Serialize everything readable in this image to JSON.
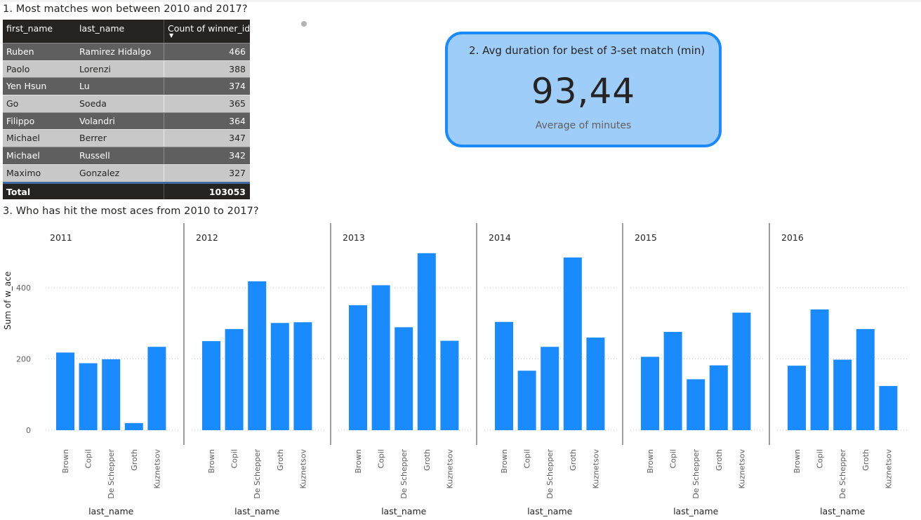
{
  "matches_table": {
    "heading": "1. Most matches won between 2010 and 2017?",
    "columns": [
      "first_name",
      "last_name",
      "Count of winner_id"
    ],
    "sort_indicator": "▼",
    "rows": [
      [
        "Ruben",
        "Ramirez Hidalgo",
        "466"
      ],
      [
        "Paolo",
        "Lorenzi",
        "388"
      ],
      [
        "Yen Hsun",
        "Lu",
        "374"
      ],
      [
        "Go",
        "Soeda",
        "365"
      ],
      [
        "Filippo",
        "Volandri",
        "364"
      ],
      [
        "Michael",
        "Berrer",
        "347"
      ],
      [
        "Michael",
        "Russell",
        "342"
      ],
      [
        "Maximo",
        "Gonzalez",
        "327"
      ]
    ],
    "total_label": "Total",
    "total_value": "103053"
  },
  "duration_card": {
    "title": "2. Avg duration for best of 3-set match (min)",
    "value": "93,44",
    "label": "Average of minutes"
  },
  "aces_chart": {
    "heading": "3. Who has hit the most aces from 2010 to 2017?"
  },
  "colors": {
    "bar": "#1a8aff",
    "card_fill": "#9fcdfa",
    "card_border": "#1a8aff",
    "table_dark": "#252423"
  },
  "chart_data": {
    "type": "bar",
    "layout": "small-multiples",
    "ylabel": "Sum of w_ace",
    "xlabel": "last_name",
    "yticks": [
      0,
      200,
      400
    ],
    "ylim": [
      0,
      520
    ],
    "grid": true,
    "categories": [
      "Brown",
      "Copil",
      "De Schepper",
      "Groth",
      "Kuznetsov"
    ],
    "panels": [
      {
        "name": "2011",
        "values": [
          218,
          188,
          199,
          20,
          234
        ]
      },
      {
        "name": "2012",
        "values": [
          250,
          284,
          418,
          301,
          303
        ]
      },
      {
        "name": "2013",
        "values": [
          351,
          407,
          289,
          497,
          251
        ]
      },
      {
        "name": "2014",
        "values": [
          304,
          167,
          234,
          485,
          260
        ]
      },
      {
        "name": "2015",
        "values": [
          206,
          276,
          143,
          182,
          330
        ]
      },
      {
        "name": "2016",
        "values": [
          181,
          339,
          198,
          284,
          124
        ]
      }
    ]
  }
}
